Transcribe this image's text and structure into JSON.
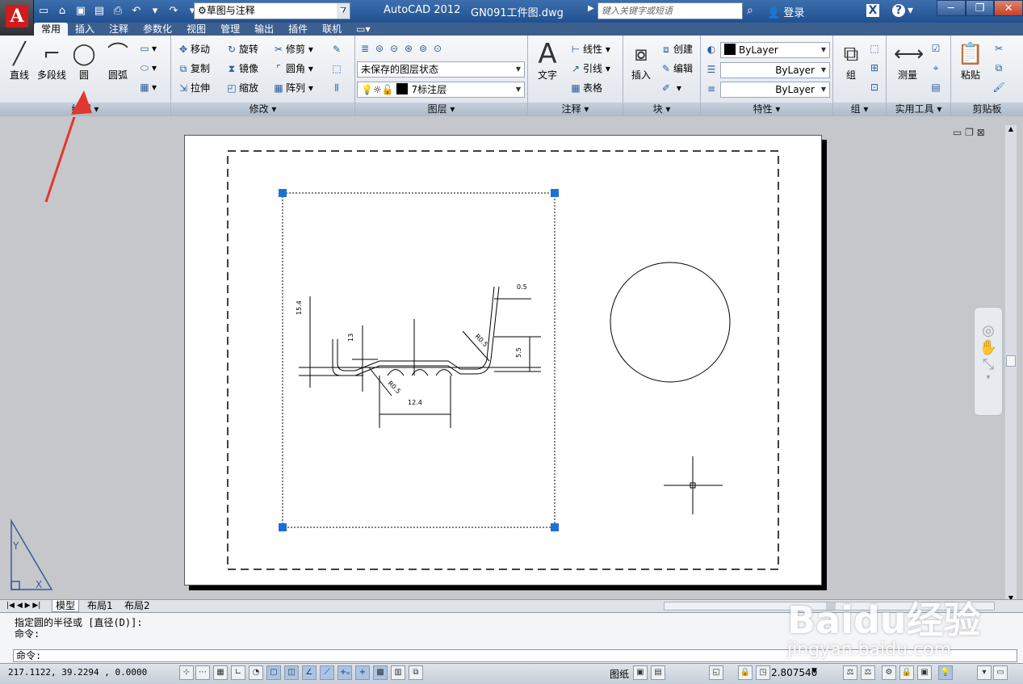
{
  "titlebar": {
    "app_name": "AutoCAD 2012",
    "file_name": "GN091工件图.dwg",
    "workspace": "草图与注释",
    "search_placeholder": "键入关键字或短语",
    "login": "登录",
    "logo_letter": "A"
  },
  "tabs": [
    "常用",
    "插入",
    "注释",
    "参数化",
    "视图",
    "管理",
    "输出",
    "插件",
    "联机"
  ],
  "ribbon": {
    "draw": {
      "title": "绘图 ▾",
      "line": "直线",
      "polyline": "多段线",
      "circle": "圆",
      "arc": "圆弧"
    },
    "modify": {
      "title": "修改 ▾",
      "move": "移动",
      "rotate": "旋转",
      "trim": "修剪",
      "copy": "复制",
      "mirror": "镜像",
      "fillet": "圆角",
      "stretch": "拉伸",
      "scale": "缩放",
      "array": "阵列"
    },
    "layers": {
      "title": "图层 ▾",
      "state": "未保存的图层状态",
      "current": "7标注层"
    },
    "annotation": {
      "title": "注释 ▾",
      "text": "文字",
      "linear": "线性",
      "leader": "引线",
      "table": "表格"
    },
    "block": {
      "title": "块 ▾",
      "insert": "插入",
      "create": "创建",
      "edit": "编辑"
    },
    "properties": {
      "title": "特性 ▾",
      "color": "ByLayer",
      "linetype": "ByLayer",
      "lineweight": "ByLayer"
    },
    "groups": {
      "title": "组 ▾",
      "group": "组"
    },
    "utilities": {
      "title": "实用工具 ▾",
      "measure": "测量"
    },
    "clipboard": {
      "title": "剪贴板",
      "paste": "粘贴"
    }
  },
  "drawing": {
    "dims": [
      "0.5",
      "R0.5",
      "5.5",
      "13",
      "15.4",
      "R0.5",
      "12.4"
    ]
  },
  "layout_tabs": [
    "模型",
    "布局1",
    "布局2"
  ],
  "command": {
    "history_1": "指定圆的半径或 [直径(D)]:",
    "history_2": "命令:",
    "prompt": "命令:"
  },
  "status": {
    "coords": "217.1122, 39.2294 , 0.0000",
    "paper": "图纸",
    "scale": "2.807540"
  },
  "watermark": {
    "logo": "Baidu经验",
    "url": "jingyan.baidu.com"
  },
  "colors": {
    "titlebar": "#21508f",
    "arrow": "#e0382e",
    "grip": "#1f6fd6",
    "logo": "#d01c1c"
  }
}
